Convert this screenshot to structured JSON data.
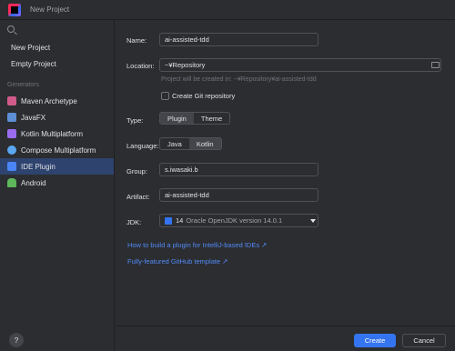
{
  "window": {
    "title": "New Project"
  },
  "sidebar": {
    "top_items": [
      {
        "label": "New Project"
      },
      {
        "label": "Empty Project"
      }
    ],
    "group_label": "Generators",
    "generators": [
      {
        "label": "Maven Archetype",
        "icon": "maven-icon",
        "color": "#d05b8a"
      },
      {
        "label": "JavaFX",
        "icon": "javafx-icon",
        "color": "#5c8fd6"
      },
      {
        "label": "Kotlin Multiplatform",
        "icon": "kotlin-icon",
        "color": "#9b6cf0"
      },
      {
        "label": "Compose Multiplatform",
        "icon": "compose-icon",
        "color": "#5aa7f2"
      },
      {
        "label": "IDE Plugin",
        "icon": "plugin-icon",
        "color": "#4a86f5",
        "selected": true
      },
      {
        "label": "Android",
        "icon": "android-icon",
        "color": "#5fb85b"
      }
    ]
  },
  "form": {
    "name_label": "Name:",
    "name_value": "ai-assisted-tdd",
    "location_label": "Location:",
    "location_value": "~¥Repository",
    "location_hint": "Project will be created in: ~¥Repository¥ai-assisted-tdd",
    "git_label": "Create Git repository",
    "type_label": "Type:",
    "type_options": [
      "Plugin",
      "Theme"
    ],
    "language_label": "Language:",
    "language_options": [
      "Java",
      "Kotlin"
    ],
    "group_label": "Group:",
    "group_value": "s.iwasaki.b",
    "artifact_label": "Artifact:",
    "artifact_value": "ai-assisted-tdd",
    "jdk_label": "JDK:",
    "jdk_version": "14",
    "jdk_value": "Oracle OpenJDK version 14.0.1",
    "link_1": "How to build a plugin for IntelliJ-based IDEs ↗",
    "link_2": "Fully-featured GitHub template ↗"
  },
  "footer": {
    "help_label": "?",
    "create_label": "Create",
    "cancel_label": "Cancel"
  }
}
